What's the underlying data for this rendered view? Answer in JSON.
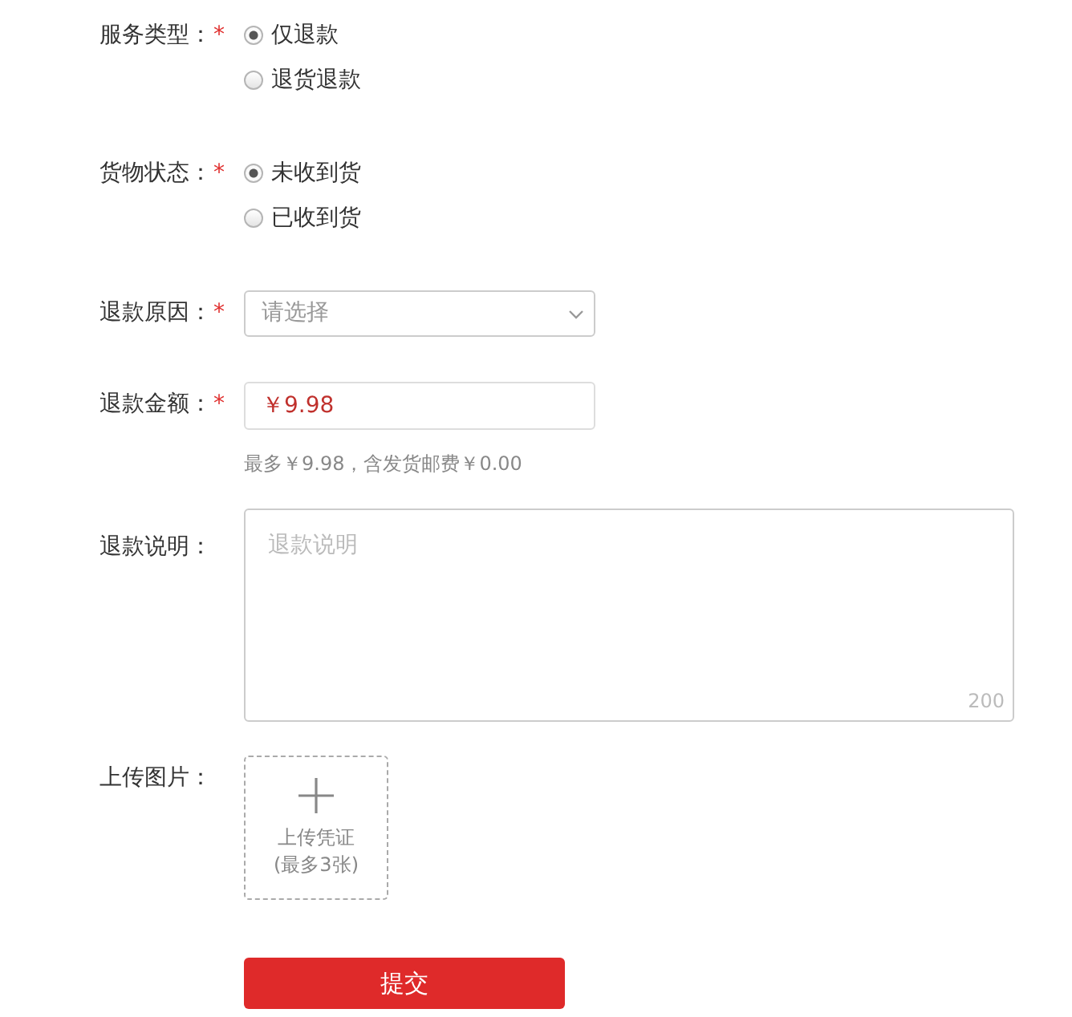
{
  "form": {
    "fields": [
      {
        "kind": "radio",
        "label": "服务类型：",
        "required_mark": "*",
        "options": [
          {
            "label": "仅退款",
            "selected": true
          },
          {
            "label": "退货退款",
            "selected": false
          }
        ]
      },
      {
        "kind": "radio",
        "label": "货物状态：",
        "required_mark": "*",
        "options": [
          {
            "label": "未收到货",
            "selected": true
          },
          {
            "label": "已收到货",
            "selected": false
          }
        ]
      },
      {
        "kind": "select",
        "label": "退款原因：",
        "required_mark": "*",
        "placeholder": "请选择"
      },
      {
        "kind": "amount",
        "label": "退款金额：",
        "required_mark": "*",
        "value": "￥9.98",
        "hint": "最多￥9.98，含发货邮费￥0.00"
      },
      {
        "kind": "textarea",
        "label": "退款说明：",
        "placeholder": "退款说明",
        "counter": "200"
      },
      {
        "kind": "upload",
        "label": "上传图片：",
        "caption": "上传凭证",
        "note": "(最多3张)"
      }
    ],
    "submit": "提交"
  }
}
